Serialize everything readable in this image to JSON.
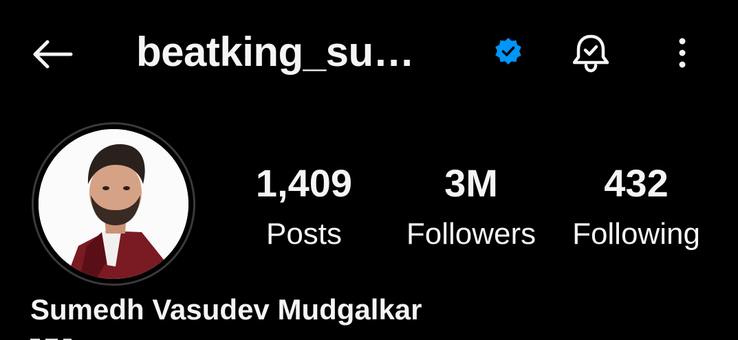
{
  "header": {
    "username": "beatking_su…",
    "back_icon": "arrow-left-icon",
    "verified_icon": "verified-badge-icon",
    "notify_icon": "bell-check-icon",
    "more_icon": "more-vertical-icon"
  },
  "profile": {
    "avatar_icon": "profile-photo",
    "full_name": "Sumedh Vasudev Mudgalkar"
  },
  "stats": [
    {
      "value": "1,409",
      "label": "Posts"
    },
    {
      "value": "3M",
      "label": "Followers"
    },
    {
      "value": "432",
      "label": "Following"
    }
  ],
  "colors": {
    "background": "#000000",
    "text": "#f5f5f5",
    "verified": "#0095f6",
    "avatar_ring": "#3a3a3a"
  }
}
